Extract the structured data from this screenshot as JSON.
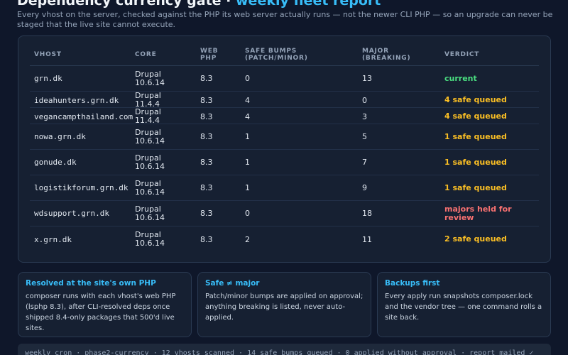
{
  "header": {
    "title": "Dependency currency gate ·",
    "title_accent": "weekly fleet report",
    "subtitle": "Every vhost on the server, checked against the PHP its web server actually runs — not the newer CLI PHP — so an upgrade can never be staged that the live site cannot execute."
  },
  "table": {
    "columns": [
      "VHOST",
      "CORE",
      "WEB PHP",
      "SAFE BUMPS (PATCH/MINOR)",
      "MAJOR (BREAKING)",
      "VERDICT"
    ],
    "rows": [
      {
        "vhost": "grn.dk",
        "core": "Drupal 10.6.14",
        "php": "8.3",
        "safe": "0",
        "major": "13",
        "verdict": "current",
        "status": "current"
      },
      {
        "vhost": "ideahunters.grn.dk",
        "core": "Drupal 11.4.4",
        "php": "8.3",
        "safe": "4",
        "major": "0",
        "verdict": "4 safe queued",
        "status": "safe"
      },
      {
        "vhost": "vegancampthailand.com",
        "core": "Drupal 11.4.4",
        "php": "8.3",
        "safe": "4",
        "major": "3",
        "verdict": "4 safe queued",
        "status": "safe"
      },
      {
        "vhost": "nowa.grn.dk",
        "core": "Drupal 10.6.14",
        "php": "8.3",
        "safe": "1",
        "major": "5",
        "verdict": "1 safe queued",
        "status": "safe"
      },
      {
        "vhost": "gonude.dk",
        "core": "Drupal 10.6.14",
        "php": "8.3",
        "safe": "1",
        "major": "7",
        "verdict": "1 safe queued",
        "status": "safe"
      },
      {
        "vhost": "logistikforum.grn.dk",
        "core": "Drupal 10.6.14",
        "php": "8.3",
        "safe": "1",
        "major": "9",
        "verdict": "1 safe queued",
        "status": "safe"
      },
      {
        "vhost": "wdsupport.grn.dk",
        "core": "Drupal 10.6.14",
        "php": "8.3",
        "safe": "0",
        "major": "18",
        "verdict": "majors held for review",
        "status": "held"
      },
      {
        "vhost": "x.grn.dk",
        "core": "Drupal 10.6.14",
        "php": "8.3",
        "safe": "2",
        "major": "11",
        "verdict": "2 safe queued",
        "status": "safe"
      }
    ]
  },
  "cards": [
    {
      "title": "Resolved at the site's own PHP",
      "body": "composer runs with each vhost's web PHP (lsphp 8.3), after CLI-resolved deps once shipped 8.4-only packages that 500'd live sites."
    },
    {
      "title": "Safe ≠ major",
      "body": "Patch/minor bumps are applied on approval; anything breaking is listed, never auto-applied."
    },
    {
      "title": "Backups first",
      "body": "Every apply run snapshots composer.lock and the vendor tree — one command rolls a site back."
    }
  ],
  "footer": {
    "text": "weekly cron · phase2-currency · 12 vhosts scanned · 14 safe bumps queued · 0 applied without approval · report mailed ✓"
  },
  "colors": {
    "background": "#0f172a",
    "card": "#162032",
    "accent": "#38bdf8",
    "current": "#4ade80",
    "safe": "#fbbf24",
    "held": "#f87171"
  }
}
